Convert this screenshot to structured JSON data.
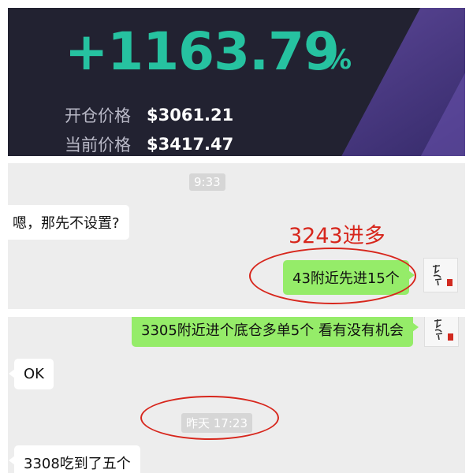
{
  "card": {
    "profit_percent": "+1163.79",
    "percent_sign": "%",
    "open_label": "开仓价格",
    "open_value": "$3061.21",
    "current_label": "当前价格",
    "current_value": "$3417.47"
  },
  "chat1": {
    "time": "9:33",
    "msg_left": "嗯，那先不设置?",
    "msg_right": "43附近先进15个",
    "annotation": "3243进多"
  },
  "chat2": {
    "msg_right": "3305附近进个底仓多单5个 看有没有机会",
    "msg_left": "OK",
    "time": "昨天 17:23",
    "msg_left_cut": "3308吃到了五个"
  },
  "colors": {
    "profit_green": "#26c2a0",
    "card_bg": "#222231",
    "bubble_green": "#95ec69",
    "annotation_red": "#d7261c"
  }
}
